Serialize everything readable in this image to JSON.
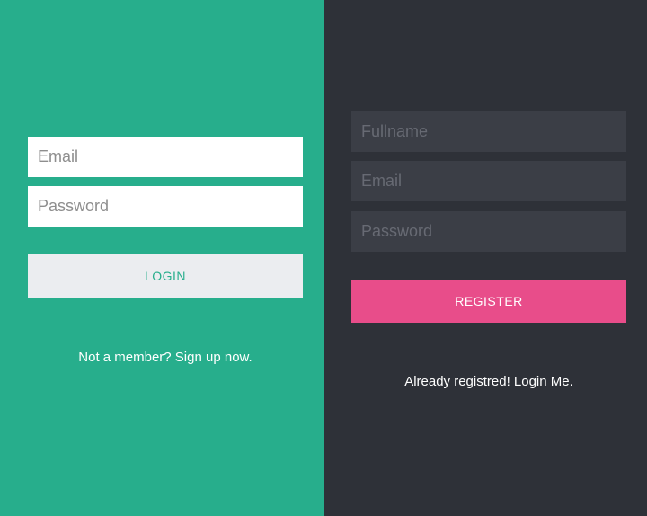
{
  "login": {
    "email_placeholder": "Email",
    "password_placeholder": "Password",
    "button_label": "LOGIN",
    "signup_link": "Not a member? Sign up now."
  },
  "register": {
    "fullname_placeholder": "Fullname",
    "email_placeholder": "Email",
    "password_placeholder": "Password",
    "button_label": "REGISTER",
    "login_link": "Already registred! Login Me."
  },
  "colors": {
    "login_panel_bg": "#27ae8c",
    "register_panel_bg": "#2e3138",
    "register_button_bg": "#e84d8a",
    "login_button_bg": "#ebedf0"
  }
}
